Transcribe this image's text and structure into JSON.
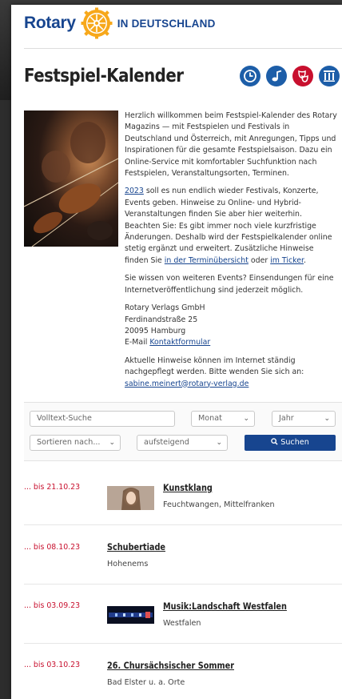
{
  "brand": {
    "name": "Rotary",
    "subtitle": "IN DEUTSCHLAND",
    "color": "#17458f",
    "gold": "#f7a81b"
  },
  "page": {
    "title": "Festspiel-Kalender"
  },
  "header_icons": [
    {
      "name": "clock-icon",
      "color": "#1d5ea8"
    },
    {
      "name": "music-note-icon",
      "color": "#1d5ea8"
    },
    {
      "name": "theatre-masks-icon",
      "color": "#c8102e"
    },
    {
      "name": "columns-icon",
      "color": "#1d5ea8"
    }
  ],
  "intro": {
    "p1": "Herzlich willkommen beim Festspiel-Kalender des Rotary Magazins — mit Festspielen und Festivals in Deutschland und Österreich, mit Anregungen, Tipps und Inspirationen für die gesamte Festspielsaison. Dazu ein Online-Service mit komfortabler Suchfunktion nach Festspielen, Veranstaltungsorten, Terminen.",
    "p2_link": "2023",
    "p2_text": " soll es nun endlich wieder Festivals, Konzerte, Events geben. Hinweise zu Online- und Hybrid-Veranstaltungen finden Sie aber hier weiterhin. Beachten Sie: Es gibt immer noch viele kurzfristige Änderungen. Deshalb wird der Festspielkalender online stetig ergänzt und erweitert. Zusätzliche Hinweise finden Sie ",
    "p2_link2": "in der Terminübersicht",
    "p2_mid": " oder ",
    "p2_link3": "im Ticker",
    "p2_end": ".",
    "p3": "Sie wissen von weiteren Events? Einsendungen für eine Internetveröffentlichung sind jederzeit möglich.",
    "addr1": "Rotary Verlags GmbH",
    "addr2": "Ferdinandstraße 25",
    "addr3": "20095 Hamburg",
    "addr4_pre": "E-Mail ",
    "addr4_link": "Kontaktformular",
    "p5": "Aktuelle Hinweise können im Internet ständig nachgepflegt werden. Bitte wenden Sie sich an:",
    "p5_link": "sabine.meinert@rotary-verlag.de"
  },
  "filter": {
    "search_placeholder": "Volltext-Suche",
    "month": "Monat",
    "year": "Jahr",
    "sort": "Sortieren nach...",
    "order": "aufsteigend",
    "search_button": "Suchen"
  },
  "events": [
    {
      "date": "... bis 21.10.23",
      "title": "Kunstklang",
      "location": "Feuchtwangen, Mittelfranken",
      "thumb": "portrait"
    },
    {
      "date": "... bis 08.10.23",
      "title": "Schubertiade",
      "location": "Hohenems",
      "thumb": ""
    },
    {
      "date": "... bis 03.09.23",
      "title": "Musik:Landschaft Westfalen",
      "location": "Westfalen",
      "thumb": "stage"
    },
    {
      "date": "... bis 03.10.23",
      "title": "26. Chursächsischer Sommer",
      "location": "Bad Elster u. a. Orte",
      "thumb": ""
    }
  ]
}
